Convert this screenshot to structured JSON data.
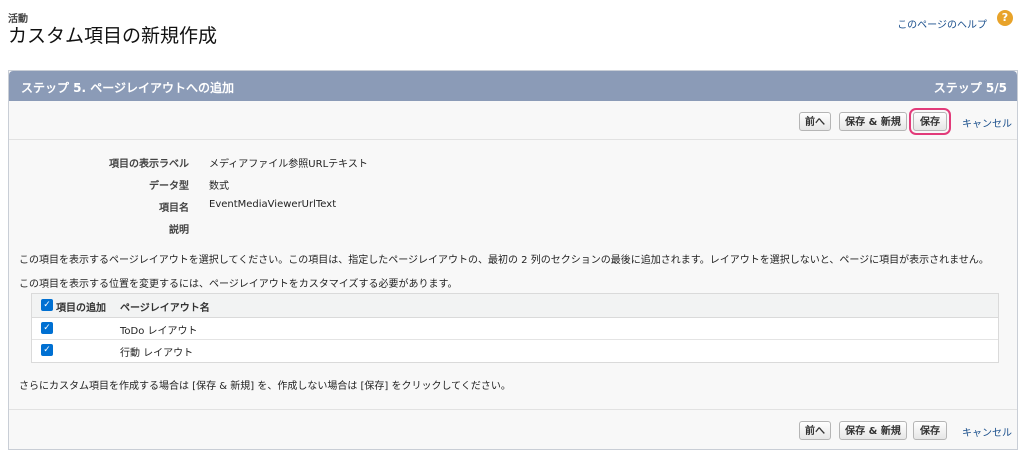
{
  "header": {
    "breadcrumb": "活動",
    "title": "カスタム項目の新規作成",
    "help_link": "このページのヘルプ",
    "help_icon": "question-icon"
  },
  "panel": {
    "title": "ステップ 5. ページレイアウトへの追加",
    "step": "ステップ 5/5"
  },
  "buttons": {
    "prev": "前へ",
    "save_new": "保存 & 新規",
    "save": "保存",
    "cancel": "キャンセル"
  },
  "fields": [
    {
      "label": "項目の表示ラベル",
      "value": "メディアファイル参照URLテキスト"
    },
    {
      "label": "データ型",
      "value": "数式"
    },
    {
      "label": "項目名",
      "value": "EventMediaViewerUrlText"
    },
    {
      "label": "説明",
      "value": ""
    }
  ],
  "info": {
    "line1": "この項目を表示するページレイアウトを選択してください。この項目は、指定したページレイアウトの、最初の 2 列のセクションの最後に追加されます。レイアウトを選択しないと、ページに項目が表示されません。",
    "line2": "この項目を表示する位置を変更するには、ページレイアウトをカスタマイズする必要があります。",
    "footer": "さらにカスタム項目を作成する場合は [保存 & 新規] を、作成しない場合は [保存] をクリックしてください。"
  },
  "layout_table": {
    "col_add": "項目の追加",
    "col_name": "ページレイアウト名",
    "rows": [
      {
        "name": "ToDo レイアウト",
        "checked": true
      },
      {
        "name": "行動 レイアウト",
        "checked": true
      }
    ]
  },
  "colors": {
    "header_bar": "#8b9bb7",
    "checkbox": "#0070d2",
    "highlight": "#e23b7a",
    "link": "#1a4f8c"
  }
}
